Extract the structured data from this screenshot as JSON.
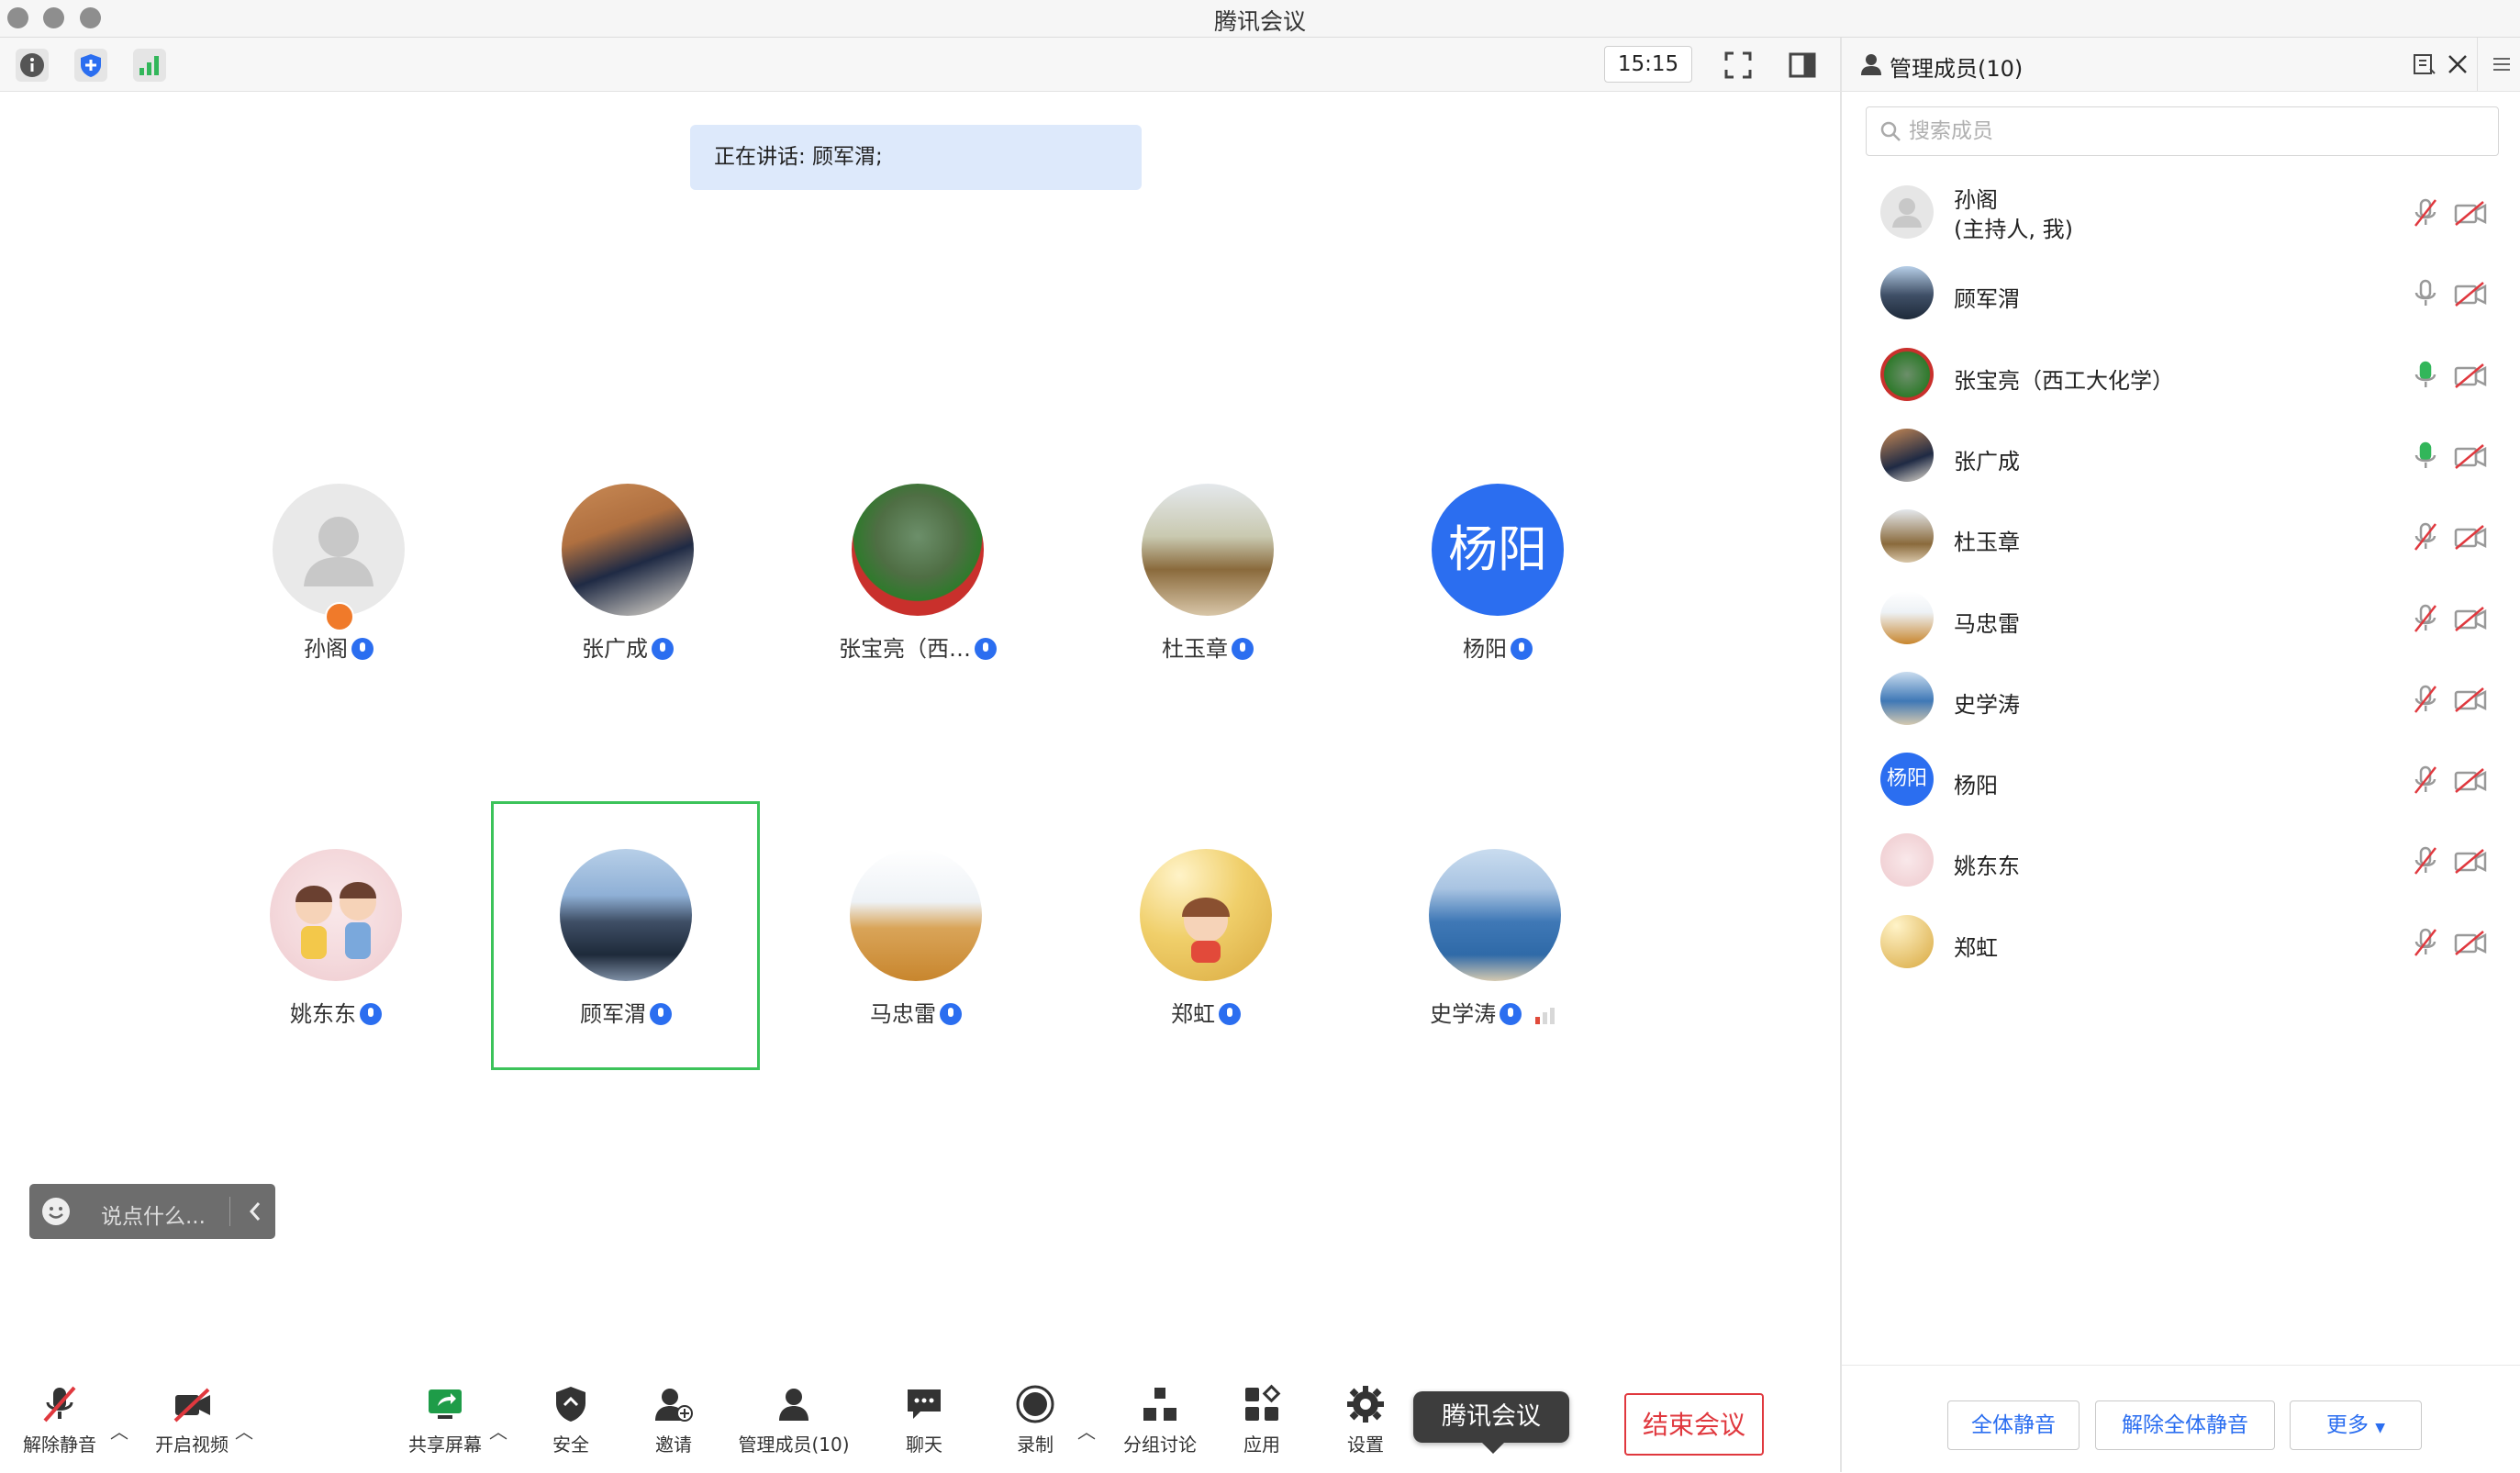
{
  "window": {
    "title": "腾讯会议"
  },
  "toolbar": {
    "time": "15:15"
  },
  "speaking": {
    "text": "正在讲话: 顾军渭;"
  },
  "grid": [
    {
      "name": "孙阁",
      "avatar": "default-person",
      "host": true
    },
    {
      "name": "张广成",
      "avatar": "photo"
    },
    {
      "name": "张宝亮（西…",
      "avatar": "photo"
    },
    {
      "name": "杜玉章",
      "avatar": "photo"
    },
    {
      "name": "杨阳",
      "avatar": "text",
      "avatar_text": "杨阳"
    },
    {
      "name": "姚东东",
      "avatar": "cartoon"
    },
    {
      "name": "顾军渭",
      "avatar": "photo",
      "selected": true
    },
    {
      "name": "马忠雷",
      "avatar": "photo"
    },
    {
      "name": "郑虹",
      "avatar": "cartoon"
    },
    {
      "name": "史学涛",
      "avatar": "photo"
    }
  ],
  "chat": {
    "placeholder": "说点什么..."
  },
  "bottombar": {
    "unmute": "解除静音",
    "video": "开启视频",
    "share": "共享屏幕",
    "security": "安全",
    "invite": "邀请",
    "members": "管理成员(10)",
    "chat": "聊天",
    "record": "录制",
    "breakout": "分组讨论",
    "apps": "应用",
    "settings": "设置",
    "tooltip": "腾讯会议",
    "end": "结束会议"
  },
  "panel": {
    "title": "管理成员(10)",
    "search_placeholder": "搜索成员",
    "members": [
      {
        "name": "孙阁",
        "sub": "(主持人, 我)",
        "mic": "muted"
      },
      {
        "name": "顾军渭",
        "mic": "on"
      },
      {
        "name": "张宝亮（西工大化学）",
        "mic": "active"
      },
      {
        "name": "张广成",
        "mic": "active"
      },
      {
        "name": "杜玉章",
        "mic": "muted"
      },
      {
        "name": "马忠雷",
        "mic": "muted"
      },
      {
        "name": "史学涛",
        "mic": "muted"
      },
      {
        "name": "杨阳",
        "mic": "muted",
        "avatar_text": "杨阳"
      },
      {
        "name": "姚东东",
        "mic": "muted"
      },
      {
        "name": "郑虹",
        "mic": "muted"
      }
    ],
    "mute_all": "全体静音",
    "unmute_all": "解除全体静音",
    "more": "更多"
  },
  "colors": {
    "accent": "#2b6ef0",
    "end": "#e0383e",
    "selected": "#3cc35a",
    "banner": "#dde9fb"
  }
}
